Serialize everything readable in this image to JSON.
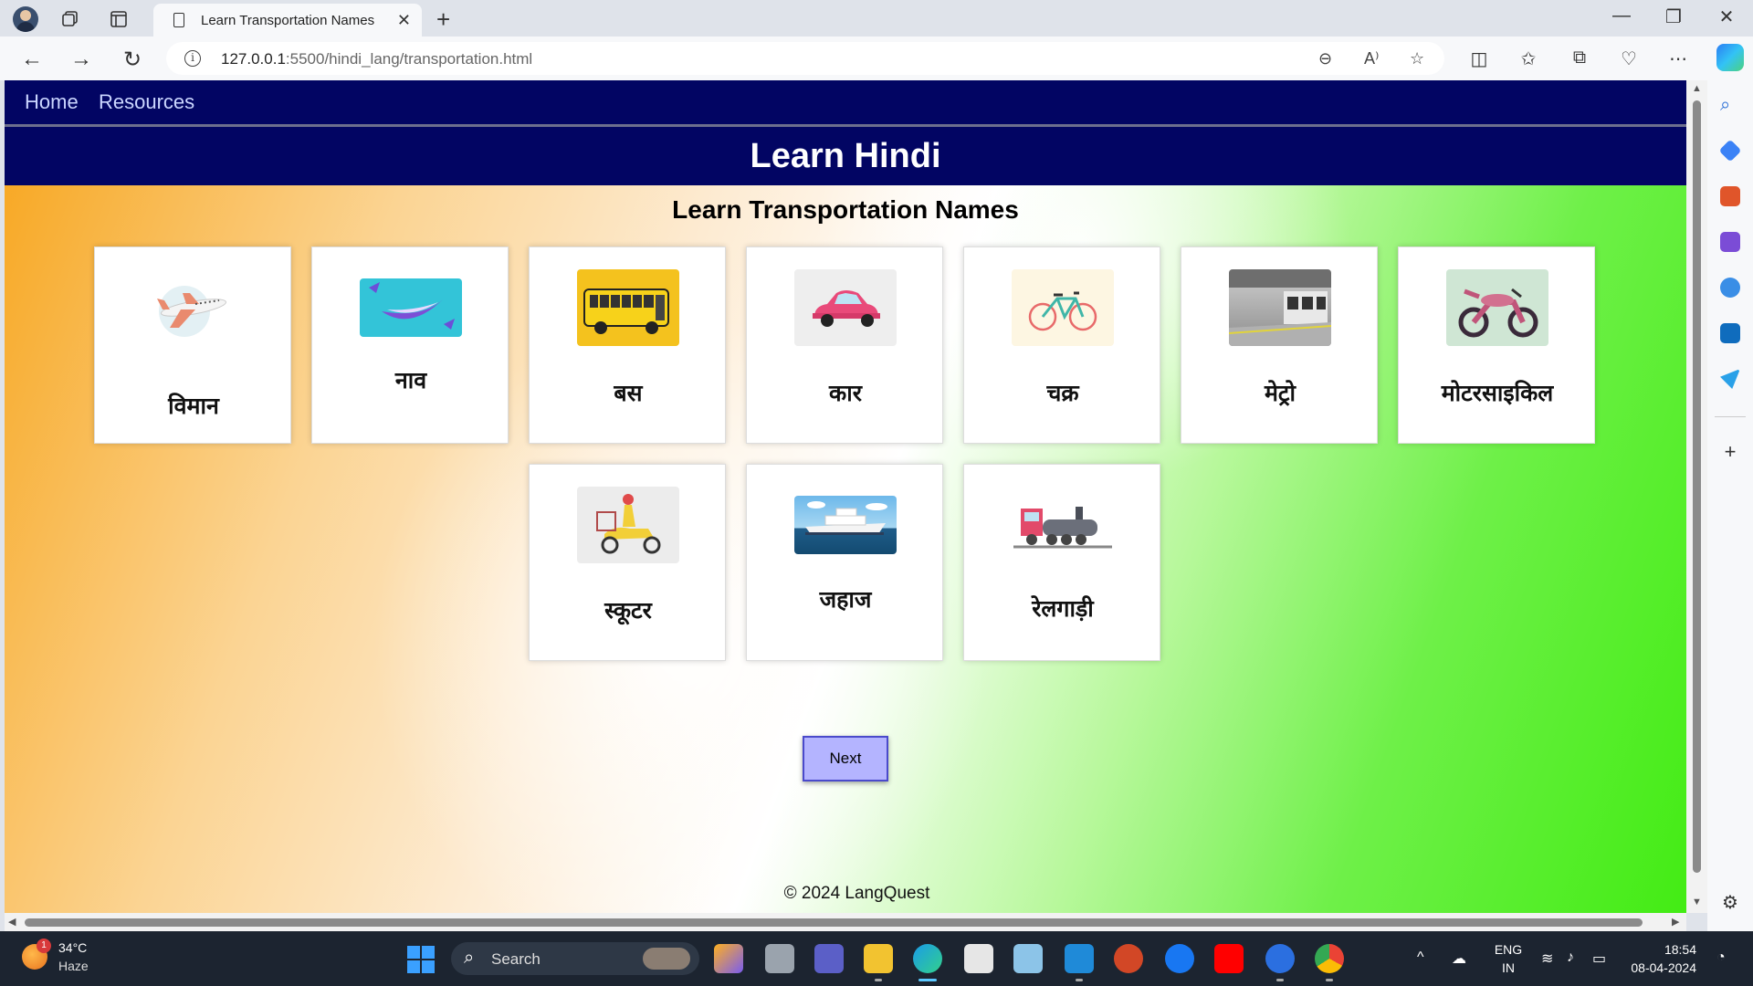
{
  "browser": {
    "tab_title": "Learn Transportation Names",
    "url_host": "127.0.0.1",
    "url_rest": ":5500/hindi_lang/transportation.html"
  },
  "nav": {
    "items": [
      "Home",
      "Resources"
    ]
  },
  "banner": {
    "title": "Learn Hindi"
  },
  "page": {
    "title": "Learn Transportation Names"
  },
  "cards": [
    {
      "label": "विमान",
      "icon": "airplane-image"
    },
    {
      "label": "नाव",
      "icon": "boat-image"
    },
    {
      "label": "बस",
      "icon": "bus-image"
    },
    {
      "label": "कार",
      "icon": "car-image"
    },
    {
      "label": "चक्र",
      "icon": "bicycle-image"
    },
    {
      "label": "मेट्रो",
      "icon": "metro-image"
    },
    {
      "label": "मोटरसाइकिल",
      "icon": "motorcycle-image"
    },
    {
      "label": "स्कूटर",
      "icon": "scooter-image"
    },
    {
      "label": "जहाज",
      "icon": "ship-image"
    },
    {
      "label": "रेलगाड़ी",
      "icon": "train-image"
    }
  ],
  "next_button": "Next",
  "footer": "© 2024 LangQuest",
  "taskbar": {
    "weather_temp": "34°C",
    "weather_cond": "Haze",
    "weather_badge": "1",
    "search_placeholder": "Search",
    "lang_line1": "ENG",
    "lang_line2": "IN",
    "time": "18:54",
    "date": "08-04-2024"
  },
  "colors": {
    "nav_bg": "#020563",
    "gradient_left": "#f7a51c",
    "gradient_right": "#43ec14",
    "next_bg": "#b4b4ff"
  }
}
